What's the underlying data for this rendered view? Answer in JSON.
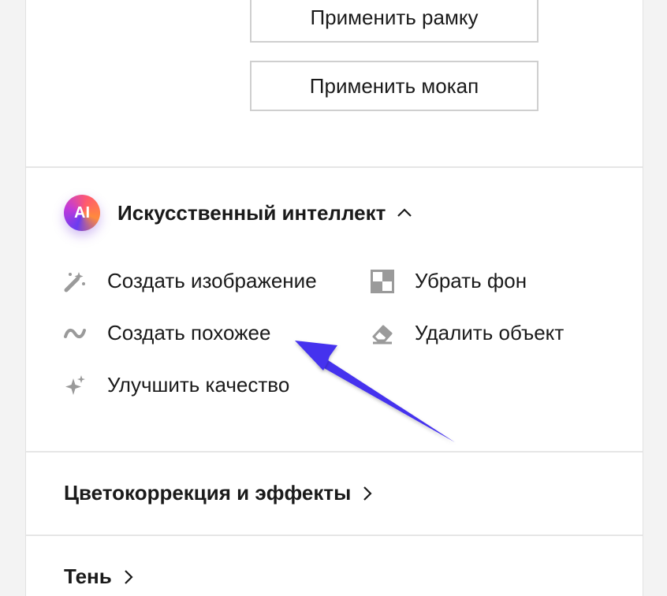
{
  "buttons": {
    "apply_frame": "Применить рамку",
    "apply_mockup": "Применить мокап"
  },
  "ai_section": {
    "badge": "AI",
    "title": "Искусственный интеллект",
    "expanded": true,
    "tools": [
      {
        "label": "Создать изображение",
        "icon": "magic-wand-icon"
      },
      {
        "label": "Убрать фон",
        "icon": "checker-icon"
      },
      {
        "label": "Создать похожее",
        "icon": "wave-icon"
      },
      {
        "label": "Удалить объект",
        "icon": "eraser-icon"
      },
      {
        "label": "Улучшить качество",
        "icon": "sparkle-icon"
      }
    ]
  },
  "color_section": {
    "title": "Цветокоррекция и эффекты",
    "expanded": false
  },
  "shadow_section": {
    "title": "Тень",
    "expanded": false
  },
  "colors": {
    "accent_arrow": "#4433ee",
    "icon_gray": "#9a9a9a",
    "divider": "#e6e6e6"
  }
}
